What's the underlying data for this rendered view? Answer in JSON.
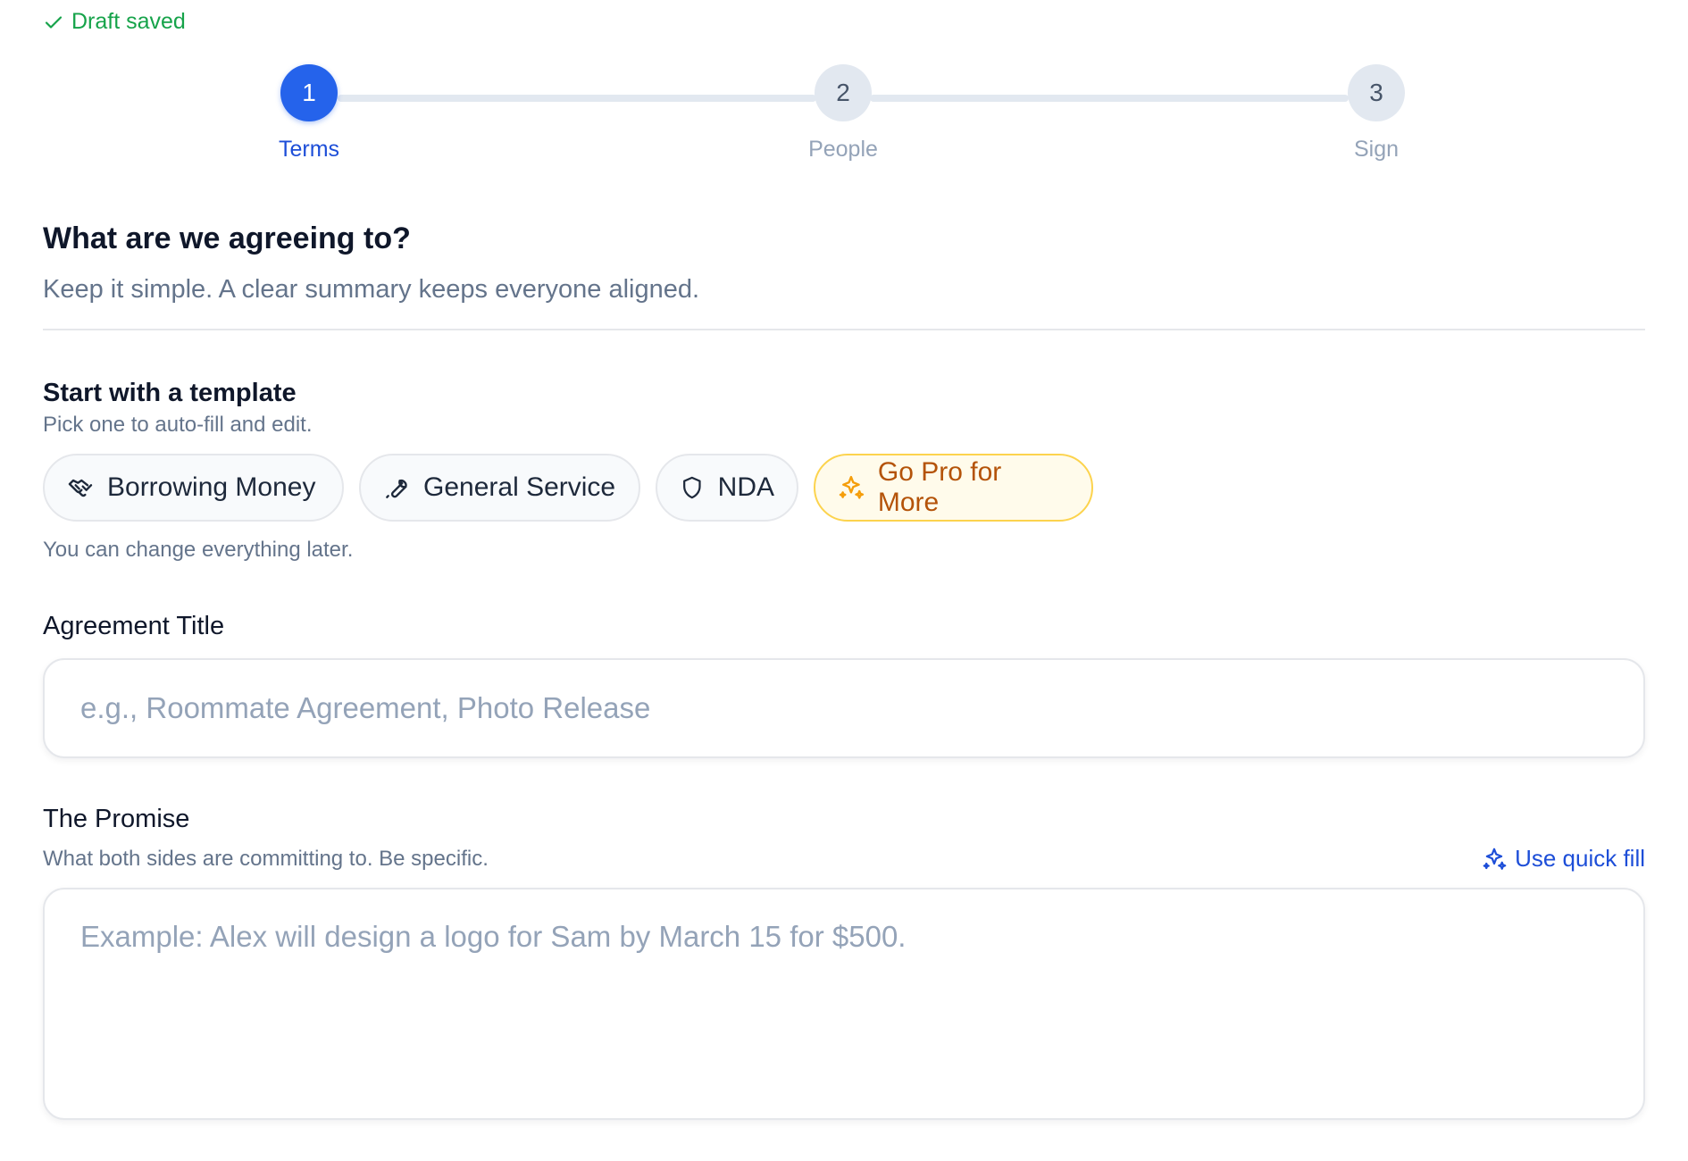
{
  "status": {
    "draft_text": "Draft saved",
    "color": "#16a34a",
    "icon": "check-icon"
  },
  "stepper": {
    "active_step": 1,
    "steps": [
      {
        "number": "1",
        "label": "Terms"
      },
      {
        "number": "2",
        "label": "People"
      },
      {
        "number": "3",
        "label": "Sign"
      }
    ]
  },
  "header": {
    "title": "What are we agreeing to?",
    "subtitle": "Keep it simple. A clear summary keeps everyone aligned."
  },
  "templates": {
    "title": "Start with a template",
    "subtitle": "Pick one to auto-fill and edit.",
    "chips": [
      {
        "label": "Borrowing Money",
        "icon": "handshake-icon"
      },
      {
        "label": "General Service",
        "icon": "wrench-icon"
      },
      {
        "label": "NDA",
        "icon": "shield-icon"
      },
      {
        "label": "Go Pro for More",
        "icon": "sparkles-icon"
      }
    ],
    "help": "You can change everything later."
  },
  "agreement_title": {
    "label": "Agreement Title",
    "value": "",
    "placeholder": "e.g., Roommate Agreement, Photo Release"
  },
  "promise": {
    "label": "The Promise",
    "subtitle": "What both sides are committing to. Be specific.",
    "quick_fill_label": "Use quick fill",
    "value": "",
    "placeholder": "Example: Alex will design a logo for Sam by March 15 for $500."
  },
  "colors": {
    "accent": "#2563eb",
    "pro": "#b45309",
    "success": "#16a34a"
  }
}
